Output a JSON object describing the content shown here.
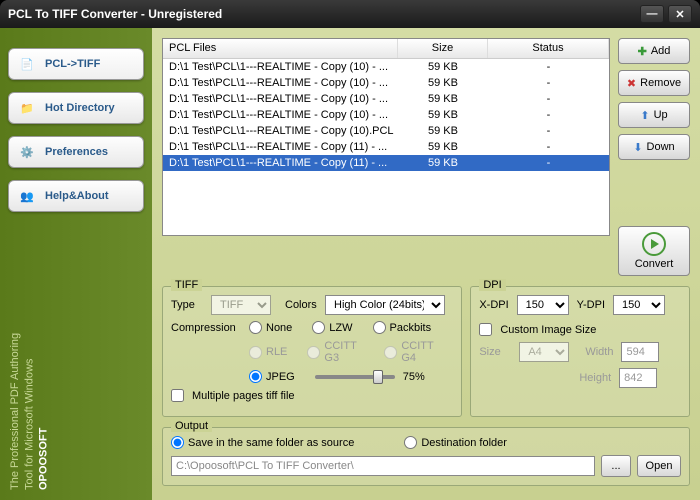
{
  "window": {
    "title": "PCL To TIFF Converter - Unregistered"
  },
  "sidebar": {
    "items": [
      {
        "label": "PCL->TIFF"
      },
      {
        "label": "Hot Directory"
      },
      {
        "label": "Preferences"
      },
      {
        "label": "Help&About"
      }
    ],
    "brand_name": "OPOOSOFT",
    "brand_tag": "The Professional PDF Authoring Tool for Microsoft Windows"
  },
  "filelist": {
    "headers": {
      "c1": "PCL Files",
      "c2": "Size",
      "c3": "Status"
    },
    "rows": [
      {
        "c1": "D:\\1 Test\\PCL\\1---REALTIME - Copy (10) - ...",
        "c2": "59 KB",
        "c3": "-"
      },
      {
        "c1": "D:\\1 Test\\PCL\\1---REALTIME - Copy (10) - ...",
        "c2": "59 KB",
        "c3": "-"
      },
      {
        "c1": "D:\\1 Test\\PCL\\1---REALTIME - Copy (10) - ...",
        "c2": "59 KB",
        "c3": "-"
      },
      {
        "c1": "D:\\1 Test\\PCL\\1---REALTIME - Copy (10) - ...",
        "c2": "59 KB",
        "c3": "-"
      },
      {
        "c1": "D:\\1 Test\\PCL\\1---REALTIME - Copy (10).PCL",
        "c2": "59 KB",
        "c3": "-"
      },
      {
        "c1": "D:\\1 Test\\PCL\\1---REALTIME - Copy (11) - ...",
        "c2": "59 KB",
        "c3": "-"
      },
      {
        "c1": "D:\\1 Test\\PCL\\1---REALTIME - Copy (11) - ...",
        "c2": "59 KB",
        "c3": "-",
        "selected": true
      }
    ]
  },
  "actions": {
    "add": "Add",
    "remove": "Remove",
    "up": "Up",
    "down": "Down",
    "convert": "Convert"
  },
  "tiff": {
    "title": "TIFF",
    "type_label": "Type",
    "type_value": "TIFF",
    "colors_label": "Colors",
    "colors_value": "High Color (24bits)",
    "comp_label": "Compression",
    "comp_opts": {
      "none": "None",
      "lzw": "LZW",
      "packbits": "Packbits",
      "rle": "RLE",
      "g3": "CCITT G3",
      "g4": "CCITT G4",
      "jpeg": "JPEG"
    },
    "jpeg_quality": "75%",
    "multipage": "Multiple pages tiff file"
  },
  "dpi": {
    "title": "DPI",
    "x_label": "X-DPI",
    "x_value": "150",
    "y_label": "Y-DPI",
    "y_value": "150",
    "custom_label": "Custom Image Size",
    "size_label": "Size",
    "size_value": "A4",
    "width_label": "Width",
    "width_value": "594",
    "height_label": "Height",
    "height_value": "842"
  },
  "output": {
    "title": "Output",
    "same_folder": "Save in the same folder as source",
    "dest_folder": "Destination folder",
    "path": "C:\\Opoosoft\\PCL To TIFF Converter\\",
    "browse": "...",
    "open": "Open"
  }
}
